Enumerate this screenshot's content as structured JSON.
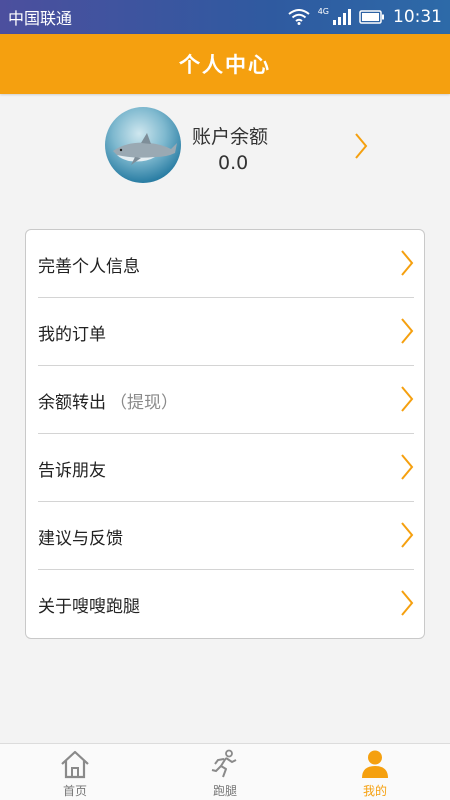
{
  "status_bar": {
    "carrier": "中国联通",
    "network": "4G",
    "time": "10:31",
    "icons": [
      "wifi-icon",
      "signal-icon",
      "battery-icon"
    ]
  },
  "header": {
    "title": "个人中心"
  },
  "account": {
    "avatar": "shark-avatar",
    "balance_label": "账户余额",
    "balance_value": "0.0"
  },
  "menu": {
    "items": [
      {
        "label": "完善个人信息",
        "sub": ""
      },
      {
        "label": "我的订单",
        "sub": ""
      },
      {
        "label": "余额转出",
        "sub": "（提现）"
      },
      {
        "label": "告诉朋友",
        "sub": ""
      },
      {
        "label": "建议与反馈",
        "sub": ""
      },
      {
        "label": "关于嗖嗖跑腿",
        "sub": ""
      }
    ]
  },
  "tabs": [
    {
      "label": "首页",
      "icon": "home-icon",
      "active": false
    },
    {
      "label": "跑腿",
      "icon": "runner-icon",
      "active": false
    },
    {
      "label": "我的",
      "icon": "user-icon",
      "active": true
    }
  ],
  "colors": {
    "accent": "#f5a00f",
    "status_bar": "#3a55a0"
  }
}
